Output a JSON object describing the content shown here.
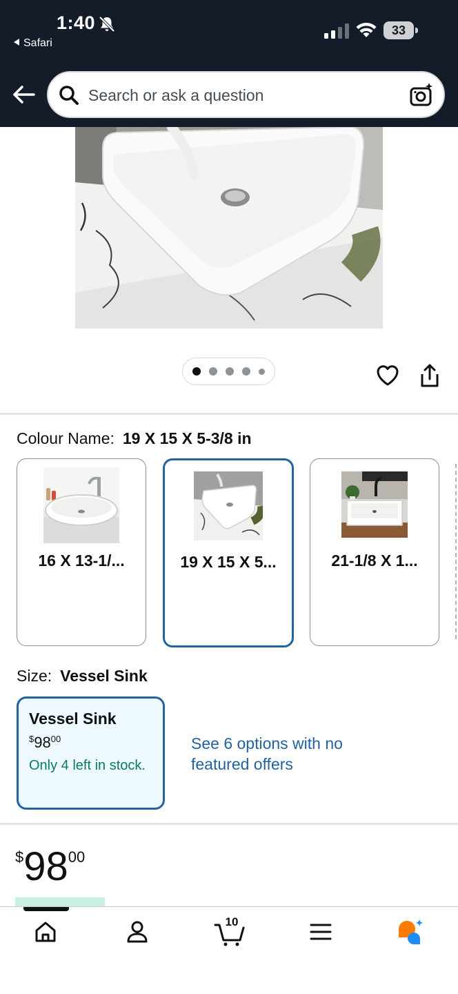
{
  "status_bar": {
    "time": "1:40",
    "back_app": "Safari",
    "battery": "33"
  },
  "search": {
    "placeholder": "Search or ask a question"
  },
  "gallery": {
    "dot_count": 5,
    "active_index": 0
  },
  "colour": {
    "label": "Colour Name:",
    "selected_value": "19 X 15 X 5-3/8 in",
    "options": [
      {
        "label": "16 X 13-1/..."
      },
      {
        "label": "19 X 15 X 5..."
      },
      {
        "label": "21-1/8 X 1..."
      }
    ],
    "selected_index": 1
  },
  "size": {
    "label": "Size:",
    "selected_value": "Vessel Sink",
    "option": {
      "name": "Vessel Sink",
      "price_symbol": "$",
      "price_whole": "98",
      "price_cents": "00",
      "stock": "Only 4 left in stock."
    },
    "see_options": "See 6 options with no featured offers"
  },
  "price": {
    "symbol": "$",
    "whole": "98",
    "cents": "00"
  },
  "tabbar": {
    "cart_count": "10",
    "active_tab": "home"
  },
  "colors": {
    "header_bg": "#151c29",
    "link": "#2162a1",
    "selected_border": "#2162a1",
    "stock_green": "#067d62",
    "ai_orange": "#ff7a00",
    "ai_blue": "#1e8cf5"
  }
}
